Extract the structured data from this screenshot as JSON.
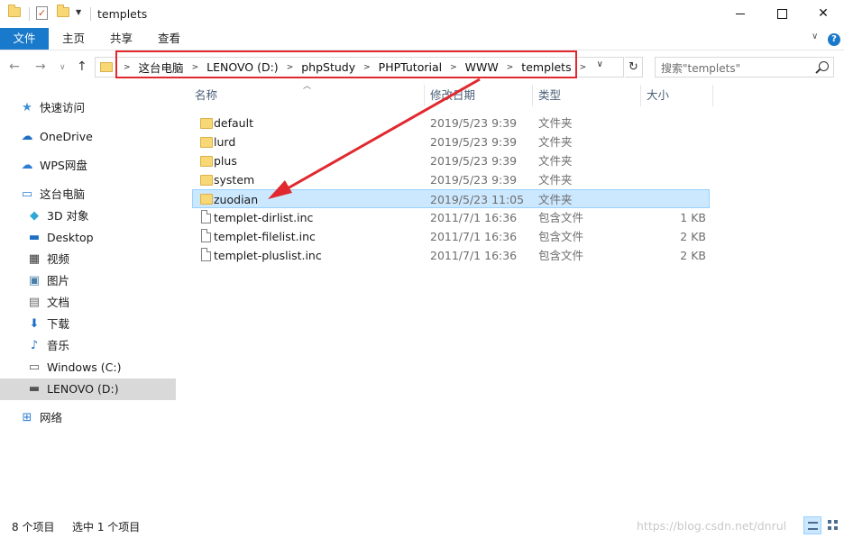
{
  "window": {
    "title": "templets",
    "minimize_glyph": "—",
    "close_glyph": "✕"
  },
  "ribbon": {
    "tabs": [
      "文件",
      "主页",
      "共享",
      "查看"
    ],
    "help_glyph": "?"
  },
  "address": {
    "crumbs": [
      "这台电脑",
      "LENOVO (D:)",
      "phpStudy",
      "PHPTutorial",
      "WWW",
      "templets"
    ],
    "refresh_glyph": "↻"
  },
  "search": {
    "placeholder": "搜索\"templets\""
  },
  "nav_pane": {
    "items": [
      {
        "label": "快速访问",
        "icon": "star-icon"
      },
      {
        "label": "OneDrive",
        "icon": "cloud-icon"
      },
      {
        "label": "WPS网盘",
        "icon": "wps-cloud-icon"
      },
      {
        "label": "这台电脑",
        "icon": "computer-icon"
      },
      {
        "label": "3D 对象",
        "icon": "3d-objects-icon"
      },
      {
        "label": "Desktop",
        "icon": "desktop-icon"
      },
      {
        "label": "视频",
        "icon": "video-icon"
      },
      {
        "label": "图片",
        "icon": "pictures-icon"
      },
      {
        "label": "文档",
        "icon": "documents-icon"
      },
      {
        "label": "下载",
        "icon": "downloads-icon"
      },
      {
        "label": "音乐",
        "icon": "music-icon"
      },
      {
        "label": "Windows (C:)",
        "icon": "drive-c-icon"
      },
      {
        "label": "LENOVO (D:)",
        "icon": "drive-d-icon",
        "selected": true
      },
      {
        "label": "网络",
        "icon": "network-icon"
      }
    ]
  },
  "columns": {
    "name": "名称",
    "modified": "修改日期",
    "type": "类型",
    "size": "大小"
  },
  "files": [
    {
      "name": "default",
      "modified": "2019/5/23 9:39",
      "type": "文件夹",
      "size": "",
      "kind": "folder"
    },
    {
      "name": "lurd",
      "modified": "2019/5/23 9:39",
      "type": "文件夹",
      "size": "",
      "kind": "folder"
    },
    {
      "name": "plus",
      "modified": "2019/5/23 9:39",
      "type": "文件夹",
      "size": "",
      "kind": "folder"
    },
    {
      "name": "system",
      "modified": "2019/5/23 9:39",
      "type": "文件夹",
      "size": "",
      "kind": "folder"
    },
    {
      "name": "zuodian",
      "modified": "2019/5/23 11:05",
      "type": "文件夹",
      "size": "",
      "kind": "folder",
      "selected": true
    },
    {
      "name": "templet-dirlist.inc",
      "modified": "2011/7/1 16:36",
      "type": "包含文件",
      "size": "1 KB",
      "kind": "file"
    },
    {
      "name": "templet-filelist.inc",
      "modified": "2011/7/1 16:36",
      "type": "包含文件",
      "size": "2 KB",
      "kind": "file"
    },
    {
      "name": "templet-pluslist.inc",
      "modified": "2011/7/1 16:36",
      "type": "包含文件",
      "size": "2 KB",
      "kind": "file"
    }
  ],
  "status": {
    "item_count": "8 个项目",
    "selected": "选中 1 个项目",
    "watermark": "https://blog.csdn.net/dnrul"
  },
  "colors": {
    "accent": "#1979ca",
    "selection": "#cce8ff",
    "annotation": "#e0282e"
  }
}
